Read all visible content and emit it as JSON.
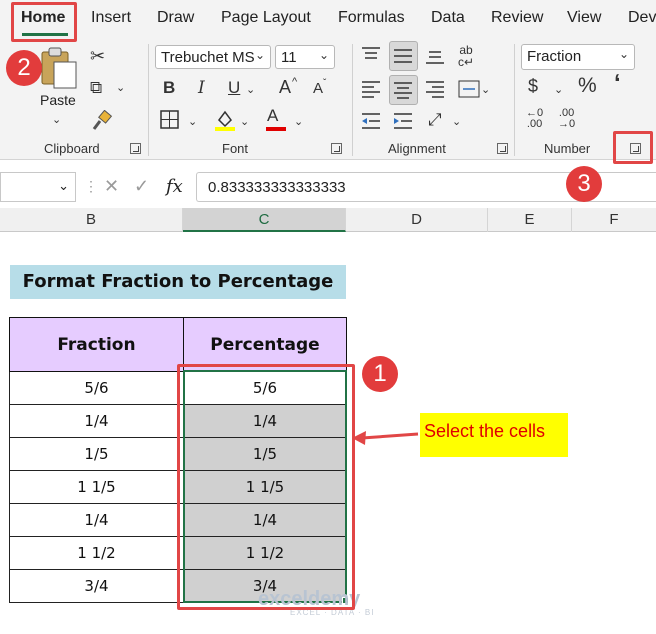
{
  "menu": {
    "tabs": [
      "Home",
      "Insert",
      "Draw",
      "Page Layout",
      "Formulas",
      "Data",
      "Review",
      "View",
      "Dev"
    ]
  },
  "ribbon": {
    "clipboard": {
      "paste_label": "Paste",
      "group_label": "Clipboard"
    },
    "font": {
      "font_name": "Trebuchet MS",
      "font_size": "11",
      "bold": "B",
      "italic": "I",
      "underline": "U",
      "grow": "A",
      "shrink": "A",
      "font_color_letter": "A",
      "group_label": "Font",
      "highlight_color": "#ffff00",
      "font_color": "#e00000"
    },
    "alignment": {
      "group_label": "Alignment"
    },
    "number": {
      "format": "Fraction",
      "currency": "$",
      "percent": "%",
      "comma": "ʻ",
      "group_label": "Number"
    }
  },
  "formula_bar": {
    "fx": "fx",
    "value": "0.833333333333333"
  },
  "columns": [
    "B",
    "C",
    "D",
    "E",
    "F"
  ],
  "sheet": {
    "title": "Format Fraction to Percentage",
    "headers": [
      "Fraction",
      "Percentage"
    ],
    "rows": [
      [
        "5/6",
        "5/6"
      ],
      [
        "1/4",
        "1/4"
      ],
      [
        "1/5",
        "1/5"
      ],
      [
        "1 1/5",
        "1 1/5"
      ],
      [
        "1/4",
        "1/4"
      ],
      [
        "1 1/2",
        "1 1/2"
      ],
      [
        "3/4",
        "3/4"
      ]
    ]
  },
  "annotations": {
    "badges": [
      "1",
      "2",
      "3"
    ],
    "callout": "Select the cells",
    "watermark": "exceldemy",
    "watermark_sub": "EXCEL · DATA · BI",
    "accent_color": "#e14646"
  }
}
